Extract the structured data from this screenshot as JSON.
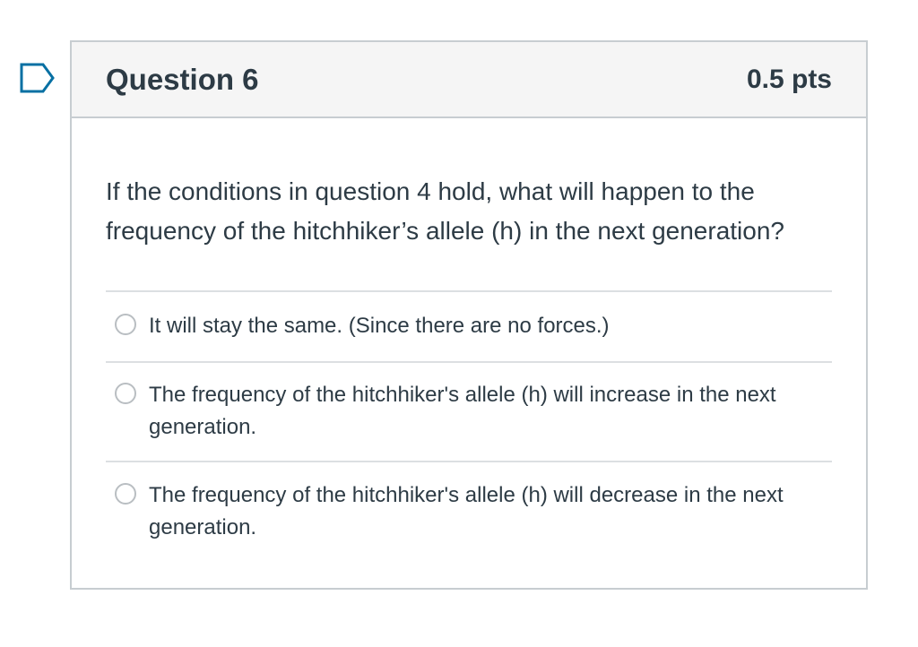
{
  "flag": {
    "icon": "bookmark-flag-icon",
    "color": "#0770a3"
  },
  "question": {
    "title": "Question 6",
    "points": "0.5 pts",
    "text": "If the conditions in question 4 hold, what will happen to the frequency of the hitchhiker’s allele (h) in the next generation?"
  },
  "answers": [
    {
      "label": "It will stay the same. (Since there are no forces.)",
      "selected": false
    },
    {
      "label": "The frequency of the hitchhiker's allele (h) will increase in the next generation.",
      "selected": false
    },
    {
      "label": "The frequency of the hitchhiker's allele (h) will decrease in the next generation.",
      "selected": false
    }
  ],
  "colors": {
    "text": "#2d3b45",
    "header_bg": "#f5f5f5",
    "border": "#c7cdd1",
    "accent": "#0770a3"
  }
}
